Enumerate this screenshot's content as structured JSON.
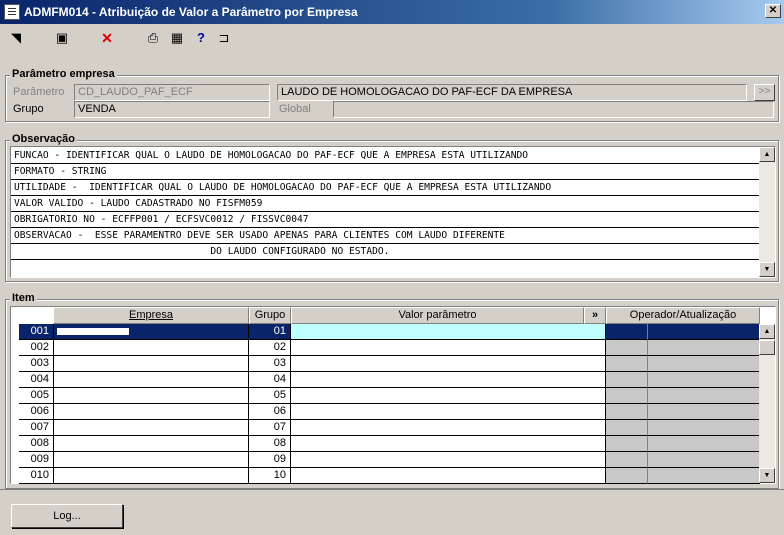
{
  "window": {
    "title": "ADMFM014 - Atribuição de Valor a Parâmetro por Empresa",
    "close_label": "✕"
  },
  "toolbar": {
    "icons": [
      "exit-icon",
      "save-icon",
      "delete-icon",
      "print-icon",
      "grid-icon",
      "help-icon",
      "door-icon"
    ],
    "exit_glyph": "◥",
    "save_glyph": "▣",
    "delete_glyph": "✕",
    "print_glyph": "⎙",
    "grid_glyph": "▦",
    "help_glyph": "?",
    "door_glyph": "⊐"
  },
  "parametro": {
    "group_label": "Parâmetro empresa",
    "parametro_label": "Parâmetro",
    "parametro_code": "CD_LAUDO_PAF_ECF",
    "parametro_desc": "LAUDO DE HOMOLOGACAO DO PAF-ECF DA EMPRESA",
    "more_label": ">>",
    "grupo_label": "Grupo",
    "grupo_value": "VENDA",
    "global_label": "Global",
    "global_value": ""
  },
  "observacao": {
    "group_label": "Observação",
    "lines": [
      "FUNCAO - IDENTIFICAR QUAL O LAUDO DE HOMOLOGACAO DO PAF-ECF QUE A EMPRESA ESTA UTILIZANDO",
      "FORMATO - STRING",
      "UTILIDADE -  IDENTIFICAR QUAL O LAUDO DE HOMOLOGACAO DO PAF-ECF QUE A EMPRESA ESTA UTILIZANDO",
      "VALOR VALIDO - LAUDO CADASTRADO NO FISFM059",
      "OBRIGATORIO NO - ECFFP001 / ECFSVC0012 / FISSVC0047",
      "OBSERVACAO -  ESSE PARAMENTRO DEVE SER USADO APENAS PARA CLIENTES COM LAUDO DIFERENTE",
      "                                  DO LAUDO CONFIGURADO NO ESTADO."
    ]
  },
  "item": {
    "group_label": "Item",
    "headers": {
      "empresa": "Empresa",
      "grupo": "Grupo",
      "valor": "Valor parâmetro",
      "more": "»",
      "operador": "Operador/Atualização"
    },
    "rows": [
      {
        "seq": "001",
        "grupo": "01"
      },
      {
        "seq": "002",
        "grupo": "02"
      },
      {
        "seq": "003",
        "grupo": "03"
      },
      {
        "seq": "004",
        "grupo": "04"
      },
      {
        "seq": "005",
        "grupo": "05"
      },
      {
        "seq": "006",
        "grupo": "06"
      },
      {
        "seq": "007",
        "grupo": "07"
      },
      {
        "seq": "008",
        "grupo": "08"
      },
      {
        "seq": "009",
        "grupo": "09"
      },
      {
        "seq": "010",
        "grupo": "10"
      }
    ]
  },
  "log_button": "Log...",
  "scroll": {
    "up": "▲",
    "down": "▼"
  }
}
